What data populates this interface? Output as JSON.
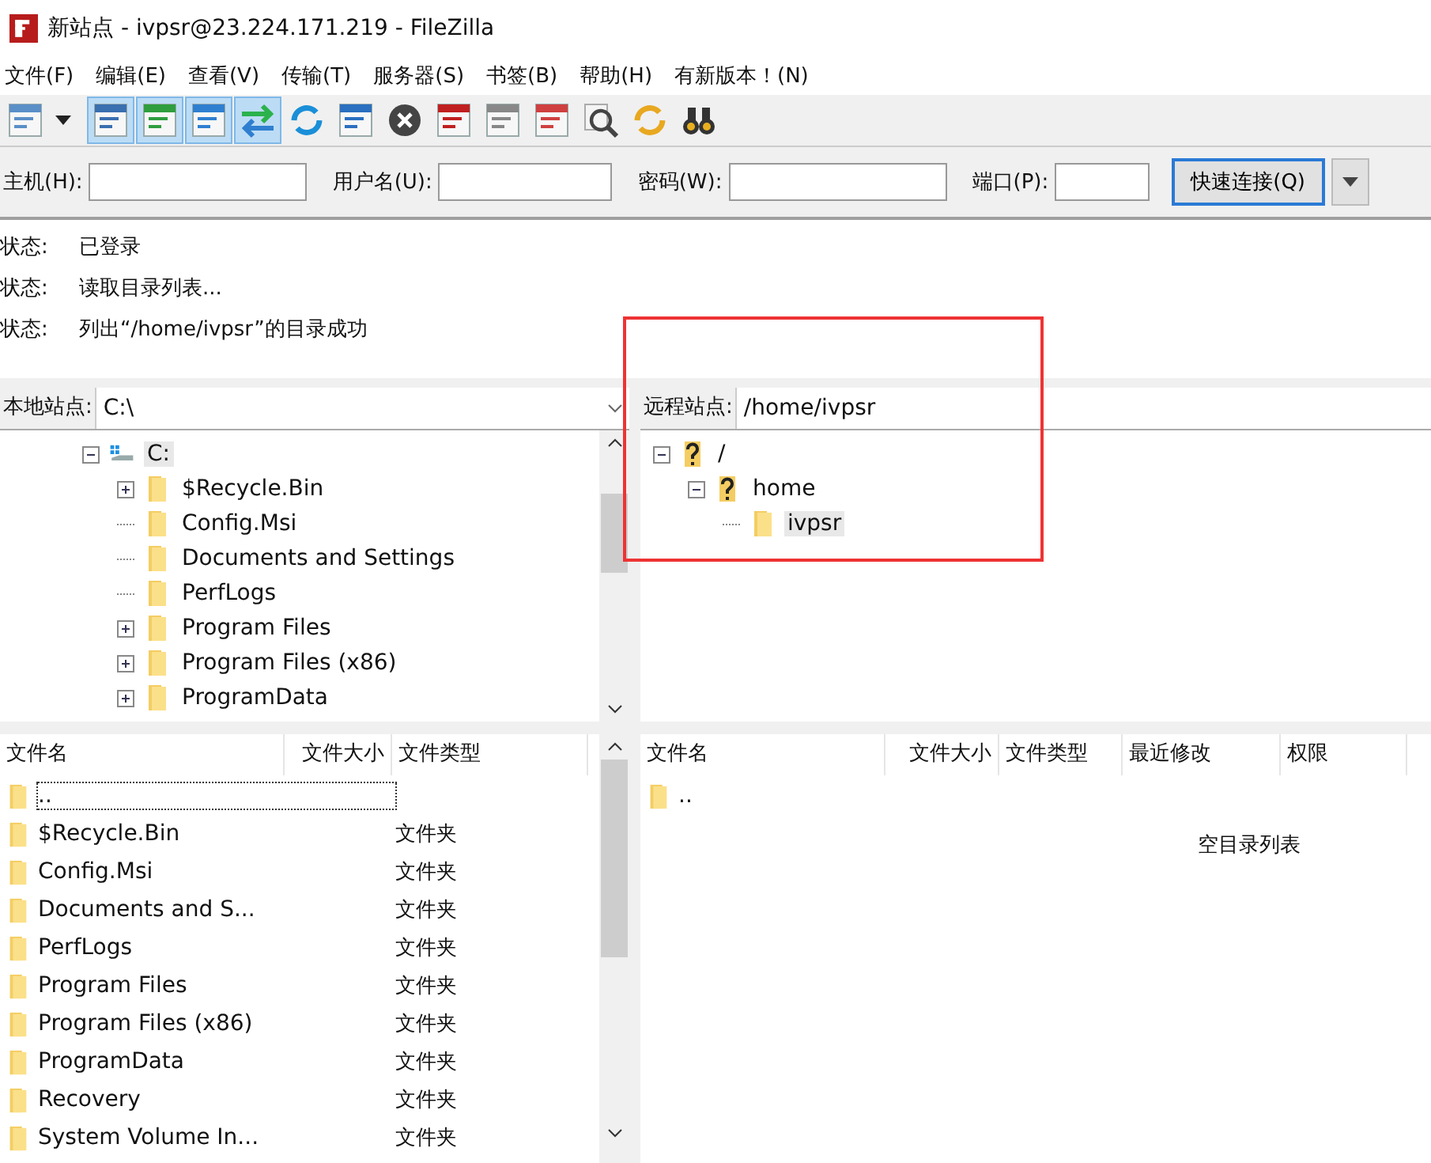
{
  "window": {
    "title": "新站点 - ivpsr@23.224.171.219 - FileZilla"
  },
  "menu": [
    "文件(F)",
    "编辑(E)",
    "查看(V)",
    "传输(T)",
    "服务器(S)",
    "书签(B)",
    "帮助(H)",
    "有新版本！(N)"
  ],
  "toolbar": [
    {
      "kind": "sites",
      "pressed": false
    },
    {
      "kind": "dropdown",
      "pressed": false
    },
    {
      "kind": "log",
      "pressed": true
    },
    {
      "kind": "localtree",
      "pressed": true
    },
    {
      "kind": "remotetree",
      "pressed": true
    },
    {
      "kind": "queue",
      "pressed": true
    },
    {
      "kind": "refresh",
      "pressed": false
    },
    {
      "kind": "filter",
      "pressed": false
    },
    {
      "kind": "cancel",
      "pressed": false
    },
    {
      "kind": "disconnect",
      "pressed": false
    },
    {
      "kind": "reconnect",
      "pressed": false
    },
    {
      "kind": "compare",
      "pressed": false
    },
    {
      "kind": "find",
      "pressed": false
    },
    {
      "kind": "sync",
      "pressed": false
    },
    {
      "kind": "binoculars",
      "pressed": false
    }
  ],
  "quickconnect": {
    "fields": [
      {
        "label": "主机(H):",
        "kind": "text"
      },
      {
        "label": "用户名(U):",
        "kind": "text"
      },
      {
        "label": "密码(W):",
        "kind": "text"
      },
      {
        "label": "端口(P):",
        "kind": "port"
      }
    ],
    "button": "快速连接(Q)"
  },
  "log": [
    {
      "prefix": "状态:",
      "message": "已登录"
    },
    {
      "prefix": "状态:",
      "message": "读取目录列表..."
    },
    {
      "prefix": "状态:",
      "message": "列出“/home/ivpsr”的目录成功"
    }
  ],
  "highlight_frame": true,
  "local": {
    "label": "本地站点:",
    "path": "C:\\",
    "tree": [
      {
        "label": "C:",
        "kind": "drive",
        "expanded": true,
        "selected": true,
        "children": [
          {
            "label": "$Recycle.Bin",
            "kind": "folder",
            "expandable": true,
            "selected": false
          },
          {
            "label": "Config.Msi",
            "kind": "folder",
            "expandable": false,
            "selected": false
          },
          {
            "label": "Documents and Settings",
            "kind": "folder",
            "expandable": false,
            "selected": false
          },
          {
            "label": "PerfLogs",
            "kind": "folder",
            "expandable": false,
            "selected": false
          },
          {
            "label": "Program Files",
            "kind": "folder",
            "expandable": true,
            "selected": false
          },
          {
            "label": "Program Files (x86)",
            "kind": "folder",
            "expandable": true,
            "selected": false
          },
          {
            "label": "ProgramData",
            "kind": "folder",
            "expandable": true,
            "selected": false
          }
        ]
      }
    ],
    "columns": [
      "文件名",
      "文件大小",
      "文件类型"
    ],
    "rows": [
      {
        "name": "..",
        "type": "",
        "focused": true
      },
      {
        "name": "$Recycle.Bin",
        "type": "文件夹",
        "focused": false
      },
      {
        "name": "Config.Msi",
        "type": "文件夹",
        "focused": false
      },
      {
        "name": "Documents and S...",
        "type": "文件夹",
        "focused": false
      },
      {
        "name": "PerfLogs",
        "type": "文件夹",
        "focused": false
      },
      {
        "name": "Program Files",
        "type": "文件夹",
        "focused": false
      },
      {
        "name": "Program Files (x86)",
        "type": "文件夹",
        "focused": false
      },
      {
        "name": "ProgramData",
        "type": "文件夹",
        "focused": false
      },
      {
        "name": "Recovery",
        "type": "文件夹",
        "focused": false
      },
      {
        "name": "System Volume In...",
        "type": "文件夹",
        "focused": false
      }
    ]
  },
  "remote": {
    "label": "远程站点:",
    "path": "/home/ivpsr",
    "tree": [
      {
        "label": "/",
        "kind": "unknown",
        "expanded": true,
        "selected": false,
        "children": [
          {
            "label": "home",
            "kind": "unknown",
            "expanded": true,
            "selected": false,
            "children": [
              {
                "label": "ivpsr",
                "kind": "folder",
                "expandable": false,
                "selected": true
              }
            ]
          }
        ]
      }
    ],
    "columns": [
      "文件名",
      "文件大小",
      "文件类型",
      "最近修改",
      "权限"
    ],
    "rows": [
      {
        "name": ".."
      }
    ],
    "empty_message": "空目录列表"
  }
}
